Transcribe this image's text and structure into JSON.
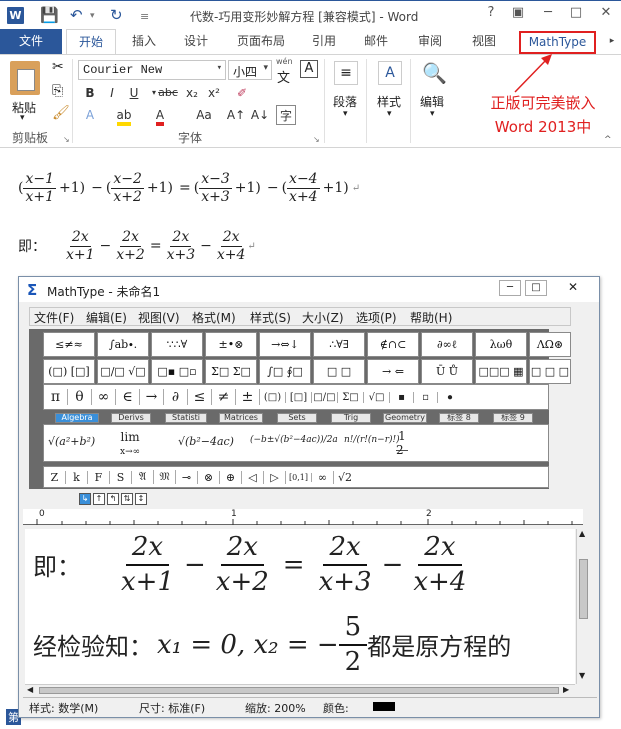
{
  "word": {
    "title": "代数-巧用变形妙解方程 [兼容模式] - Word",
    "logo": "W",
    "tabs": [
      "文件",
      "开始",
      "插入",
      "设计",
      "页面布局",
      "引用",
      "邮件",
      "审阅",
      "视图",
      "MathType"
    ],
    "font_name": "Courier New",
    "font_size": "小四",
    "groups": {
      "clipboard": "剪贴板",
      "font": "字体",
      "paragraph": "段落",
      "styles": "样式",
      "editing": "编辑"
    },
    "paste_label": "粘贴",
    "wen": "wén",
    "annotation_line1": "正版可完美嵌入",
    "annotation_line2": "Word 2013中",
    "status_left": "第"
  },
  "document": {
    "line1": {
      "lhs_a_num": "x−1",
      "lhs_a_den": "x+1",
      "lhs_b_num": "x−2",
      "lhs_b_den": "x+2",
      "rhs_a_num": "x−3",
      "rhs_a_den": "x+3",
      "rhs_b_num": "x−4",
      "rhs_b_den": "x+4"
    },
    "line2": {
      "prefix": "即：",
      "a_num": "2x",
      "a_den": "x+1",
      "b_num": "2x",
      "b_den": "x+2",
      "c_num": "2x",
      "c_den": "x+3",
      "d_num": "2x",
      "d_den": "x+4"
    }
  },
  "mathtype": {
    "title": "MathType - 未命名1",
    "menu": [
      "文件(F)",
      "编辑(E)",
      "视图(V)",
      "格式(M)",
      "样式(S)",
      "大小(Z)",
      "选项(P)",
      "帮助(H)"
    ],
    "palette_row1": [
      "≤≠≈",
      "∫ab∙.",
      "∵∴∀",
      "±•⊗",
      "→⇔↓",
      "∴∀∃",
      "∉∩⊂",
      "∂∞ℓ",
      "λωθ",
      "ΛΩ⊛"
    ],
    "palette_row2": [
      "(□) [□]",
      "□/□ √□",
      "□▪ □▫",
      "Σ□ Σ□",
      "∫□ ∮□",
      "□ □",
      "→ ⇐",
      "Ū Ů",
      "□□□ ▦",
      "□ □ □"
    ],
    "symbol_row": [
      "π",
      "θ",
      "∞",
      "∈",
      "→",
      "∂",
      "≤",
      "≠",
      "±",
      "(□)",
      "[□]",
      "□/□",
      "Σ□",
      "√□",
      "▪",
      "▫",
      "⦁"
    ],
    "tabs": [
      "Algebra",
      "Derivs",
      "Statisti",
      "Matrices",
      "Sets",
      "Trig",
      "Geometry",
      "标签 8",
      "标签 9"
    ],
    "templates": [
      "√(a²+b²)",
      "lim x→∞",
      "√(b²−4ac)",
      "(−b±√(b²−4ac))/2a",
      "n!/(r!(n−r)!)",
      "1/2"
    ],
    "small_row": [
      "Z",
      "k",
      "F",
      "S",
      "𝔄",
      "𝔐",
      "⊸",
      "⊗",
      "⊕",
      "◁",
      "▷",
      "[0,1]",
      "∞",
      "√2"
    ],
    "ruler_marks": [
      "0",
      "1",
      "2"
    ],
    "edit_line1": {
      "prefix": "即：",
      "a_num": "2x",
      "a_den": "x+1",
      "b_num": "2x",
      "b_den": "x+2",
      "c_num": "2x",
      "c_den": "x+3",
      "d_num": "2x",
      "d_den": "x+4"
    },
    "edit_line2": {
      "text": "经检验知：",
      "expr": "x₁ = 0, x₂ = −",
      "frac_num": "5",
      "frac_den": "2",
      "suffix": "都是原方程的"
    },
    "status": {
      "style": "样式: 数学(M)",
      "size": "尺寸: 标准(F)",
      "zoom": "缩放: 200%",
      "color": "颜色:"
    }
  }
}
